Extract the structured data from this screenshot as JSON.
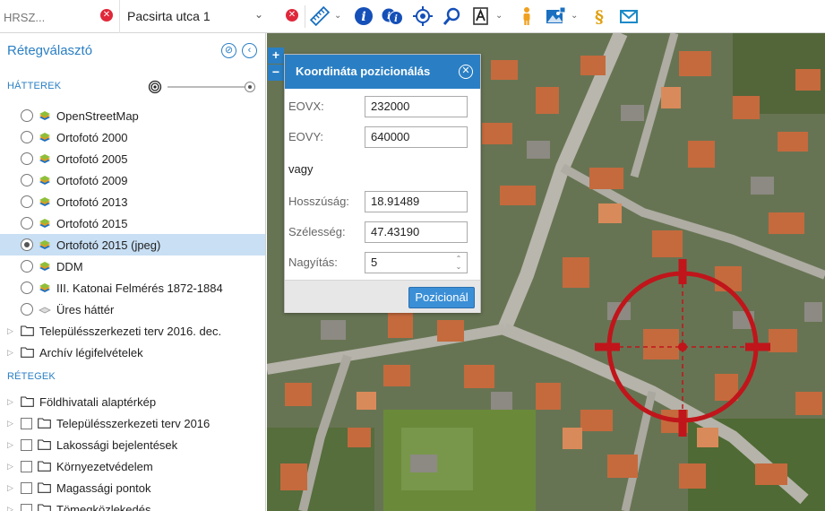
{
  "toolbar": {
    "hrsz_placeholder": "HRSZ...",
    "street_value": "Pacsirta utca 1",
    "icons": [
      "clear-icon",
      "dropdown-icon",
      "clear-icon",
      "ruler-icon",
      "info-icon",
      "multi-info-icon",
      "crosshair-icon",
      "search-icon",
      "print-icon",
      "person-icon",
      "image-icon",
      "paragraph-icon",
      "mail-icon"
    ]
  },
  "sidebar": {
    "title": "Rétegválasztó",
    "section_background": "HÁTTEREK",
    "section_layers": "RÉTEGEK",
    "backgrounds": [
      {
        "label": "OpenStreetMap",
        "selected": false
      },
      {
        "label": "Ortofotó 2000",
        "selected": false
      },
      {
        "label": "Ortofotó 2005",
        "selected": false
      },
      {
        "label": "Ortofotó 2009",
        "selected": false
      },
      {
        "label": "Ortofotó 2013",
        "selected": false
      },
      {
        "label": "Ortofotó 2015",
        "selected": false
      },
      {
        "label": "Ortofotó 2015 (jpeg)",
        "selected": true
      },
      {
        "label": "DDM",
        "selected": false
      },
      {
        "label": "III. Katonai Felmérés 1872-1884",
        "selected": false
      },
      {
        "label": "Üres háttér",
        "selected": false
      }
    ],
    "background_groups": [
      "Településszerkezeti terv 2016. dec.",
      "Archív légifelvételek"
    ],
    "layers": [
      {
        "label": "Földhivatali alaptérkép",
        "checkbox": false
      },
      {
        "label": "Településszerkezeti terv 2016",
        "checkbox": true
      },
      {
        "label": "Lakossági bejelentések",
        "checkbox": true
      },
      {
        "label": "Környezetvédelem",
        "checkbox": true
      },
      {
        "label": "Magassági pontok",
        "checkbox": true
      },
      {
        "label": "Tömegközlekedés",
        "checkbox": true
      }
    ]
  },
  "dialog": {
    "title": "Koordináta pozicionálás",
    "eovx_label": "EOVX:",
    "eovx_value": "232000",
    "eovy_label": "EOVY:",
    "eovy_value": "640000",
    "or_text": "vagy",
    "lon_label": "Hosszúság:",
    "lon_value": "18.91489",
    "lat_label": "Szélesség:",
    "lat_value": "47.43190",
    "zoom_label": "Nagyítás:",
    "zoom_value": "5",
    "submit_label": "Pozicionál"
  },
  "map": {
    "zoom_in": "+",
    "zoom_out": "−"
  },
  "colors": {
    "accent": "#2a7fc4",
    "target": "#c0151b",
    "clear": "#e0283a"
  }
}
